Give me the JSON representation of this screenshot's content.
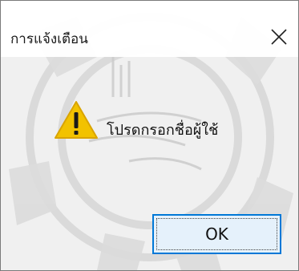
{
  "dialog": {
    "title": "การแจ้งเตือน",
    "message": "โปรดกรอกชื่อผู้ใช้",
    "ok_label": "OK",
    "close_icon": "close-icon",
    "warning_icon": "warning-icon",
    "colors": {
      "accent": "#0078d7",
      "warning": "#f2c200",
      "background": "#f0f0f0"
    }
  }
}
